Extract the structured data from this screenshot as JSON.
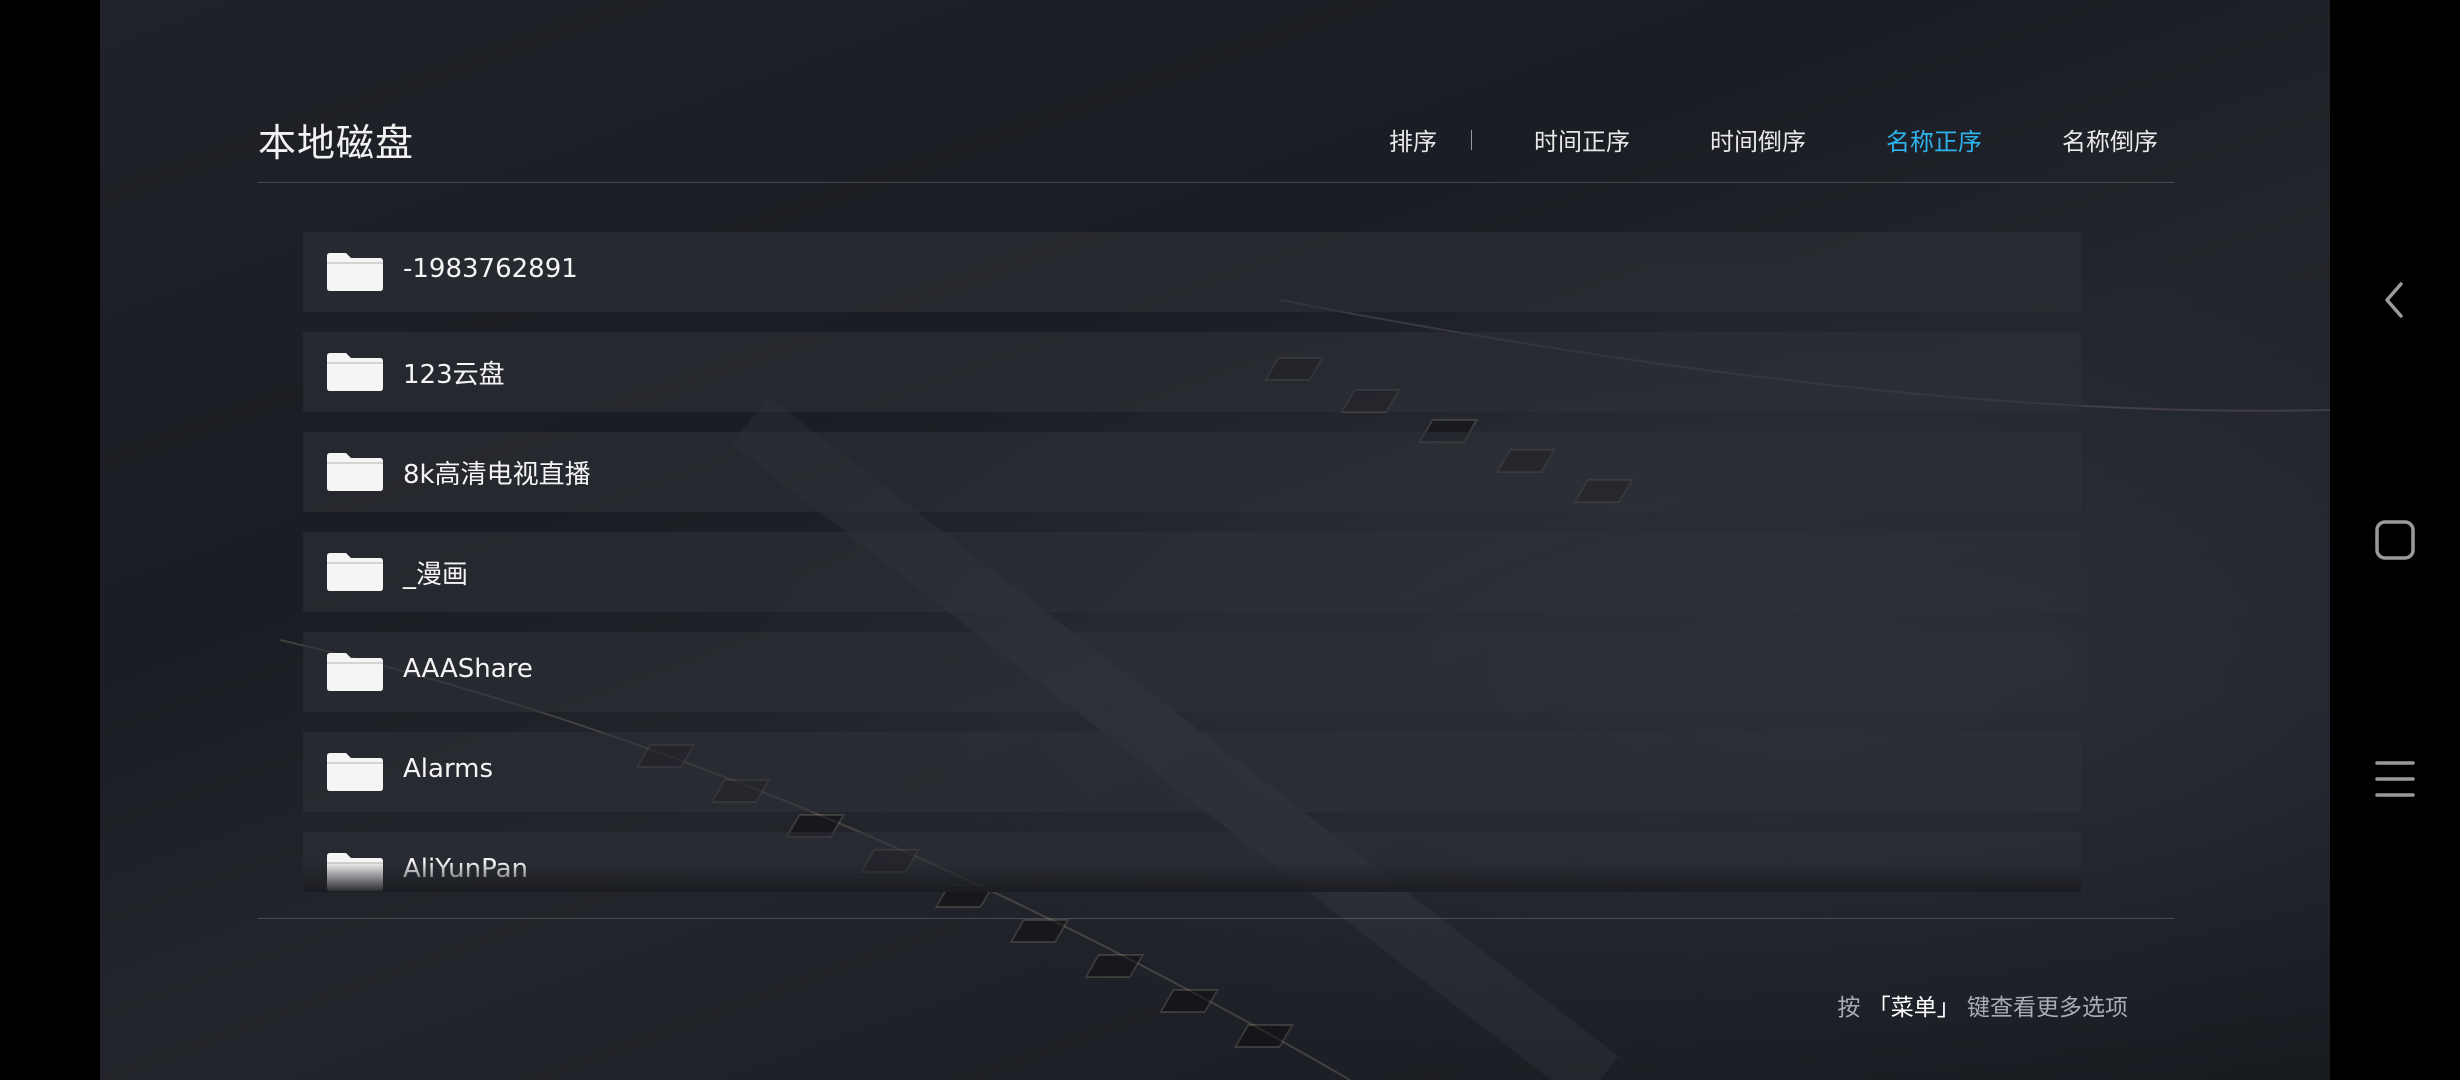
{
  "header": {
    "title": "本地磁盘",
    "sort_label": "排序",
    "sort_options": [
      {
        "label": "时间正序",
        "active": false
      },
      {
        "label": "时间倒序",
        "active": false
      },
      {
        "label": "名称正序",
        "active": true
      },
      {
        "label": "名称倒序",
        "active": false
      }
    ],
    "active_color": "#2fb3ee"
  },
  "files": [
    {
      "name": "-1983762891",
      "icon": "folder-icon"
    },
    {
      "name": "123云盘",
      "icon": "folder-icon"
    },
    {
      "name": "8k高清电视直播",
      "icon": "folder-icon"
    },
    {
      "name": "_漫画",
      "icon": "folder-icon"
    },
    {
      "name": "AAAShare",
      "icon": "folder-icon"
    },
    {
      "name": "Alarms",
      "icon": "folder-icon"
    },
    {
      "name": "AliYunPan",
      "icon": "folder-icon"
    }
  ],
  "footer": {
    "hint_prefix": "按",
    "hint_key": "「菜单」",
    "hint_suffix": "键查看更多选项"
  },
  "system_nav": {
    "back": "back-icon",
    "home": "home-icon",
    "menu": "menu-icon"
  }
}
